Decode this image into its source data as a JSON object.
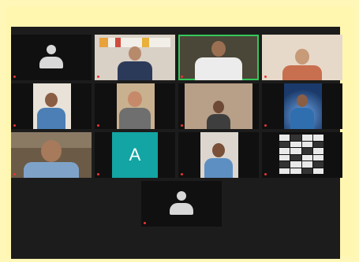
{
  "window": {
    "background": "#fff7b8"
  },
  "tiles": [
    {
      "id": "tile-1",
      "name": "",
      "kind": "avatar"
    },
    {
      "id": "tile-2",
      "name": "",
      "kind": "video",
      "bg": "#d9d0c6",
      "shirt": "#2c3a5a"
    },
    {
      "id": "tile-3",
      "name": "",
      "kind": "video",
      "bg": "#4a4638",
      "shirt": "#ececec",
      "active": true
    },
    {
      "id": "tile-4",
      "name": "",
      "kind": "video",
      "bg": "#e7d9c9",
      "shirt": "#c86f50"
    },
    {
      "id": "tile-5",
      "name": "",
      "kind": "video",
      "bg": "#e8e2d8",
      "shirt": "#4b7fb5"
    },
    {
      "id": "tile-6",
      "name": "",
      "kind": "video",
      "bg": "#c9b18f",
      "shirt": "#6f6f6f"
    },
    {
      "id": "tile-7",
      "name": "",
      "kind": "video",
      "bg": "#b79f88",
      "shirt": "#3e3e3e"
    },
    {
      "id": "tile-8",
      "name": "",
      "kind": "video",
      "bg": "#1b3a6b",
      "shirt": "#2f6fb0"
    },
    {
      "id": "tile-9",
      "name": "",
      "kind": "video",
      "bg": "#6b5a46",
      "shirt": "#7fa3c8"
    },
    {
      "id": "tile-10",
      "name": "",
      "kind": "letter",
      "letter": "A"
    },
    {
      "id": "tile-11",
      "name": "",
      "kind": "video",
      "bg": "#dcd6cf",
      "shirt": "#5e8fc2"
    },
    {
      "id": "tile-12",
      "name": "",
      "kind": "screen"
    },
    {
      "id": "tile-13",
      "name": "",
      "kind": "avatar"
    }
  ]
}
